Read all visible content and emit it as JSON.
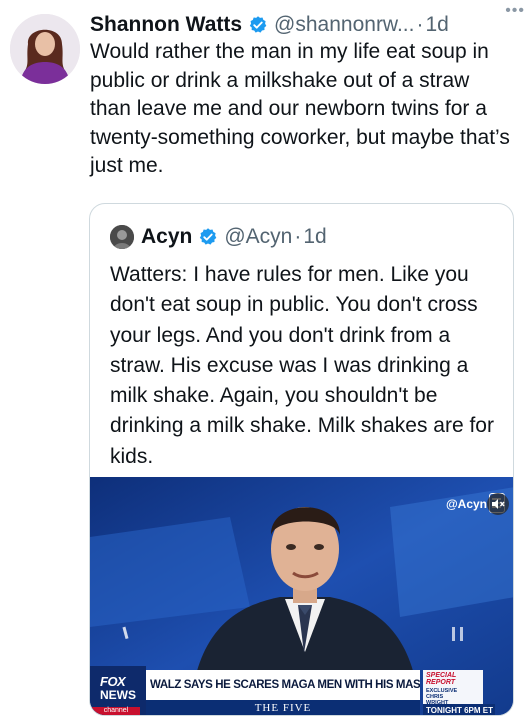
{
  "tweet": {
    "author_name": "Shannon Watts",
    "handle": "@shannonrw...",
    "separator": "·",
    "time": "1d",
    "more_icon": "more-dots-icon",
    "verified_icon": "verified-badge-icon",
    "verified_color": "#1d9bf0",
    "text": "Would rather the man in my life eat soup in public or drink a milkshake out of a straw than leave me and our newborn twins for a twenty-something coworker, but maybe that’s just me."
  },
  "quote": {
    "author_name": "Acyn",
    "handle": "@Acyn",
    "separator": "·",
    "time": "1d",
    "text": "Watters: I have rules for men. Like you don't eat soup in public. You don't cross your legs. And you don't drink from a straw. His excuse was I was drinking a milk shake. Again, you shouldn't be drinking a milk shake. Milk shakes are for kids.",
    "media": {
      "watermark": "@Acyn",
      "watermark_icon": "document-icon",
      "network_logo_top": "FOX",
      "network_logo_bottom": "NEWS",
      "network_channel": "channel",
      "headline": "WALZ SAYS HE SCARES MAGA MEN WITH HIS MASCULINITY",
      "show_name": "THE FIVE",
      "special_report": "SPECIAL REPORT",
      "exclusive": "EXCLUSIVE CHRIS WRIGHT",
      "tonight": "TONIGHT 6PM ET",
      "mute_icon": "mute-speaker-icon"
    }
  }
}
